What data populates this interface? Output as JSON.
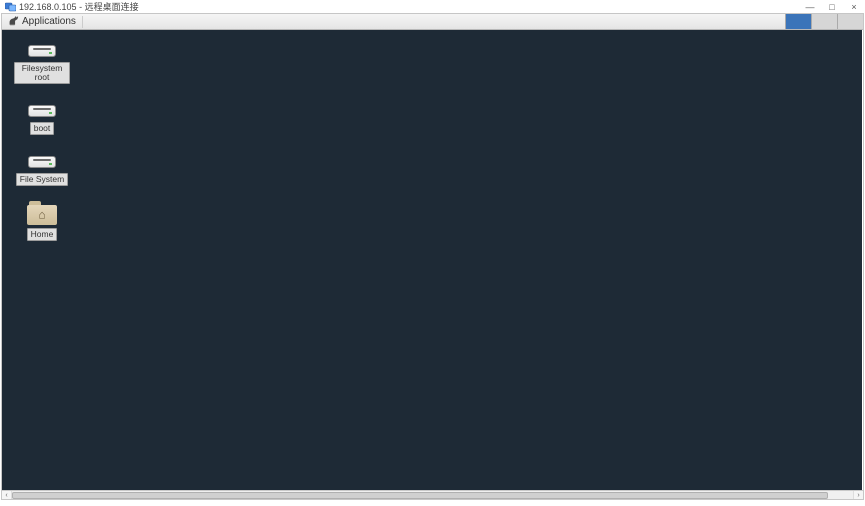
{
  "rdp": {
    "ip": "192.168.0.105",
    "title_suffix": "远程桌面连接",
    "title_separator": " - "
  },
  "window_controls": {
    "minimize": "—",
    "maximize": "□",
    "close": "×"
  },
  "panel": {
    "applications_label": "Applications"
  },
  "desktop_icons": [
    {
      "id": "fs-root",
      "type": "drive",
      "label": "Filesystem root"
    },
    {
      "id": "boot",
      "type": "drive",
      "label": "boot"
    },
    {
      "id": "fs",
      "type": "drive",
      "label": "File System"
    },
    {
      "id": "home",
      "type": "folder",
      "label": "Home"
    }
  ],
  "colors": {
    "desktop_bg": "#1e2a36",
    "panel_accent": "#3b74b9"
  }
}
